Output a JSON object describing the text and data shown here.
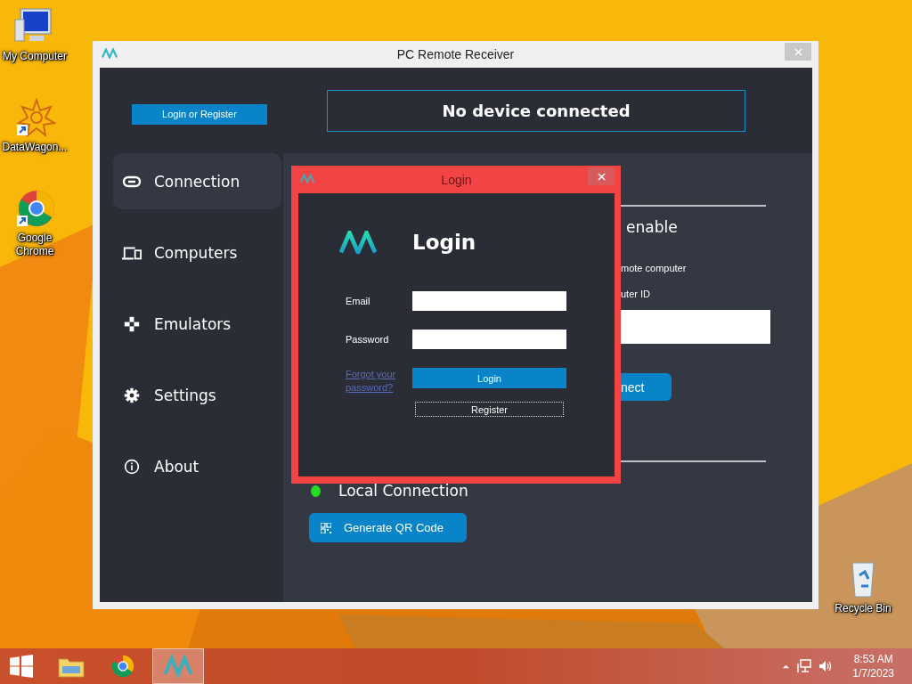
{
  "desktop": {
    "icons": [
      {
        "kind": "computer",
        "label": "My Computer"
      },
      {
        "kind": "shortcut",
        "label": "DataWagon..."
      },
      {
        "kind": "browser",
        "label": "Google Chrome"
      },
      {
        "kind": "recycle",
        "label": "Recycle Bin"
      }
    ]
  },
  "window": {
    "title": "PC Remote Receiver"
  },
  "header": {
    "login_button": "Login or Register",
    "status": "No device connected"
  },
  "sidebar": {
    "items": [
      {
        "kind": "link",
        "label": "Connection",
        "selected": true
      },
      {
        "kind": "computers",
        "label": "Computers",
        "selected": false
      },
      {
        "kind": "gamepad",
        "label": "Emulators",
        "selected": false
      },
      {
        "kind": "gear",
        "label": "Settings",
        "selected": false
      },
      {
        "kind": "info",
        "label": "About",
        "selected": false
      }
    ]
  },
  "connection_panel": {
    "heading": "enable",
    "description": "mote computer",
    "id_label": "uter ID",
    "connect_button": "nect",
    "local_connection": {
      "label": "Local Connection",
      "online": true
    },
    "qr_button": "Generate QR Code"
  },
  "login_dialog": {
    "title": "Login",
    "heading": "Login",
    "fields": [
      {
        "label": "Email"
      },
      {
        "label": "Password"
      }
    ],
    "forgot_link": "Forgot your password?",
    "login_button": "Login",
    "register_button": "Register"
  },
  "taskbar": {
    "apps": [
      {
        "kind": "explorer",
        "selected": false
      },
      {
        "kind": "browser",
        "selected": false
      },
      {
        "kind": "remote",
        "selected": true
      }
    ],
    "time": "8:53 AM",
    "date": "1/7/2023"
  }
}
